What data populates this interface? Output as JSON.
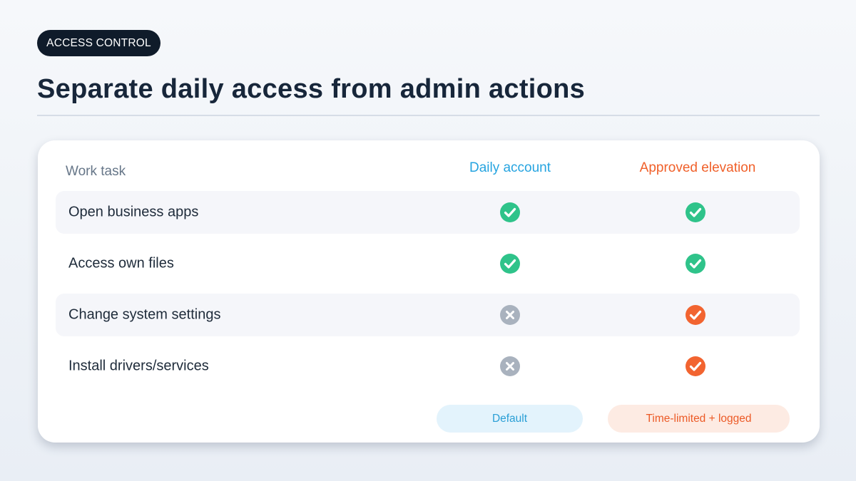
{
  "tag": "ACCESS CONTROL",
  "title": "Separate daily access from admin actions",
  "table": {
    "headers": {
      "task": "Work task",
      "daily": "Daily account",
      "elevation": "Approved elevation"
    },
    "rows": [
      {
        "label": "Open business apps",
        "daily": "allowed",
        "elevation": "allowed"
      },
      {
        "label": "Access own files",
        "daily": "allowed",
        "elevation": "allowed"
      },
      {
        "label": "Change system settings",
        "daily": "denied",
        "elevation": "allowed-elevated"
      },
      {
        "label": "Install drivers/services",
        "daily": "denied",
        "elevation": "allowed-elevated"
      }
    ],
    "footer": {
      "daily": "Default",
      "elevation": "Time-limited + logged"
    }
  },
  "colors": {
    "allowed": "#2fc38a",
    "elevated": "#f26430",
    "denied": "#a9b2be",
    "daily_accent": "#26a4e0",
    "elevation_accent": "#f0602a"
  },
  "icons": {
    "allowed": "check-circle-icon",
    "allowed-elevated": "check-circle-icon",
    "denied": "x-circle-icon"
  }
}
